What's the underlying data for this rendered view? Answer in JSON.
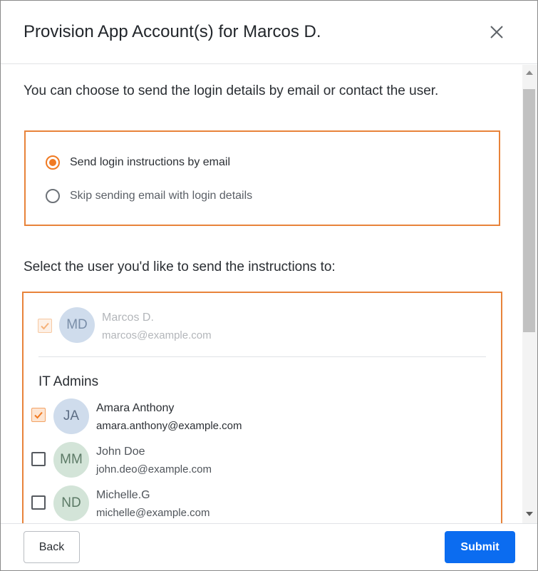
{
  "dialog": {
    "title": "Provision App Account(s) for Marcos D.",
    "close_icon": "close-icon"
  },
  "intro_text": "You can choose to send the login details by email or contact the user.",
  "delivery_options": [
    {
      "label": "Send login instructions by email",
      "checked": true
    },
    {
      "label": "Skip sending email with login details",
      "checked": false
    }
  ],
  "select_users_prompt": "Select the user you'd like to send the instructions to:",
  "primary_user": {
    "initials": "MD",
    "name": "Marcos D.",
    "email": "marcos@example.com",
    "checked": true,
    "disabled": true,
    "avatar_color": "#cfdcec"
  },
  "group": {
    "title": "IT Admins",
    "members": [
      {
        "initials": "JA",
        "name": "Amara Anthony",
        "email": "amara.anthony@example.com",
        "checked": true,
        "avatar_color": "#cfdcec"
      },
      {
        "initials": "MM",
        "name": "John Doe",
        "email": "john.deo@example.com",
        "checked": false,
        "avatar_color": "#d3e4d8"
      },
      {
        "initials": "ND",
        "name": "Michelle.G",
        "email": "michelle@example.com",
        "checked": false,
        "avatar_color": "#d3e4d8"
      }
    ]
  },
  "footer": {
    "back_label": "Back",
    "submit_label": "Submit"
  },
  "colors": {
    "accent_orange": "#f07a22",
    "highlight_border": "#e8833a",
    "primary_blue": "#0b6cf0"
  }
}
